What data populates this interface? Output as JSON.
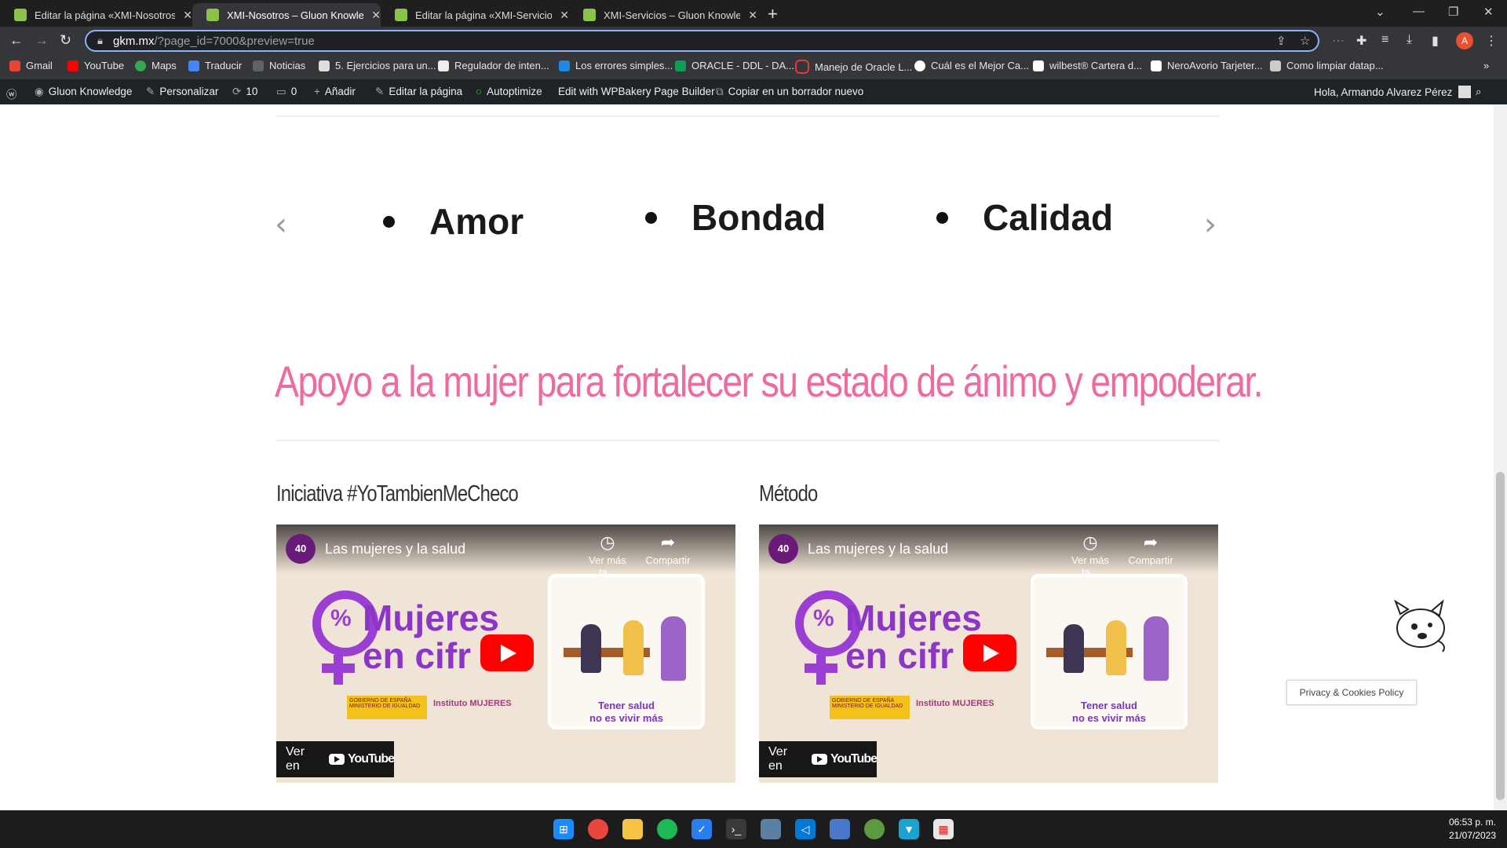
{
  "browser": {
    "tabs": [
      {
        "title": "Editar la página «XMI-Nosotros»",
        "active": false
      },
      {
        "title": "XMI-Nosotros – Gluon Knowledge",
        "active": true
      },
      {
        "title": "Editar la página «XMI-Servicios»",
        "active": false
      },
      {
        "title": "XMI-Servicios – Gluon Knowledge",
        "active": false
      }
    ],
    "url_host": "gkm.mx",
    "url_path": "/?page_id=7000&preview=true",
    "profile_initial": "A",
    "bookmarks": [
      "Gmail",
      "YouTube",
      "Maps",
      "Traducir",
      "Noticias",
      "5. Ejercicios para un...",
      "Regulador de inten...",
      "Los errores simples...",
      "ORACLE - DDL - DA...",
      "Manejo de Oracle L...",
      "Cuál es el Mejor Ca...",
      "wilbest® Cartera d...",
      "NeroAvorio Tarjeter...",
      "Como limpiar datap..."
    ]
  },
  "admin_bar": {
    "site": "Gluon Knowledge",
    "customize": "Personalizar",
    "updates": "10",
    "comments": "0",
    "add": "Añadir",
    "edit_page": "Editar la página",
    "autoptimize": "Autoptimize",
    "wpbakery": "Edit with WPBakery Page Builder",
    "copy_draft": "Copiar en un borrador nuevo",
    "greeting": "Hola, Armando Alvarez Pérez"
  },
  "page": {
    "values": [
      "Amor",
      "Bondad",
      "Calidad"
    ],
    "headline": "Apoyo a la mujer para fortalecer su estado de ánimo y empoderar.",
    "videos": [
      {
        "section_title": "Iniciativa #YoTambienMeCheco",
        "channel": "40",
        "title": "Las mujeres y la salud",
        "watch_later": "Ver más ta...",
        "share": "Compartir",
        "big_line1": "Mujeres",
        "big_line2": "en cifr",
        "logos_text": "GOBIERNO DE ESPAÑA   MINISTERIO DE IGUALDAD",
        "institute": "Instituto MUJERES",
        "card_text_1": "Tener salud",
        "card_text_2": "no es vivir más",
        "watch_on": "Ver en",
        "yt_word": "YouTube"
      },
      {
        "section_title": "Método",
        "channel": "40",
        "title": "Las mujeres y la salud",
        "watch_later": "Ver más ta...",
        "share": "Compartir",
        "big_line1": "Mujeres",
        "big_line2": "en cifr",
        "logos_text": "GOBIERNO DE ESPAÑA   MINISTERIO DE IGUALDAD",
        "institute": "Instituto MUJERES",
        "card_text_1": "Tener salud",
        "card_text_2": "no es vivir más",
        "watch_on": "Ver en",
        "yt_word": "YouTube"
      }
    ],
    "cookie_label": "Privacy & Cookies Policy"
  },
  "taskbar": {
    "time": "06:53 p. m.",
    "date": "21/07/2023"
  },
  "colors": {
    "headline_pink": "#f06aa0",
    "purple": "#8c35c9",
    "youtube_red": "#ff0000",
    "wp_bar": "#1d2327"
  }
}
